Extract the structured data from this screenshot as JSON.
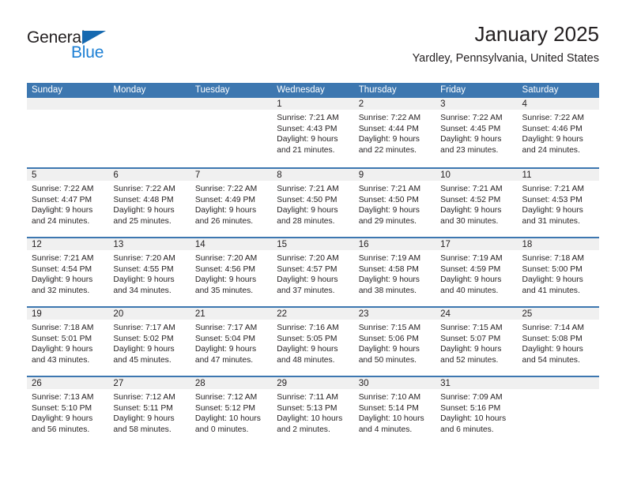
{
  "brand": {
    "name_part1": "General",
    "name_part2": "Blue",
    "triangle_icon": "triangle-icon",
    "colors": {
      "dark": "#231f20",
      "blue": "#1c7fd4",
      "triangle": "#1669b0"
    }
  },
  "header": {
    "month_title": "January 2025",
    "location": "Yardley, Pennsylvania, United States"
  },
  "calendar": {
    "header_color": "#3d77b0",
    "day_band_color": "#f0f0f0",
    "day_names": [
      "Sunday",
      "Monday",
      "Tuesday",
      "Wednesday",
      "Thursday",
      "Friday",
      "Saturday"
    ],
    "weeks": [
      [
        {
          "day": "",
          "empty": true
        },
        {
          "day": "",
          "empty": true
        },
        {
          "day": "",
          "empty": true
        },
        {
          "day": "1",
          "sunrise": "Sunrise: 7:21 AM",
          "sunset": "Sunset: 4:43 PM",
          "daylight1": "Daylight: 9 hours",
          "daylight2": "and 21 minutes."
        },
        {
          "day": "2",
          "sunrise": "Sunrise: 7:22 AM",
          "sunset": "Sunset: 4:44 PM",
          "daylight1": "Daylight: 9 hours",
          "daylight2": "and 22 minutes."
        },
        {
          "day": "3",
          "sunrise": "Sunrise: 7:22 AM",
          "sunset": "Sunset: 4:45 PM",
          "daylight1": "Daylight: 9 hours",
          "daylight2": "and 23 minutes."
        },
        {
          "day": "4",
          "sunrise": "Sunrise: 7:22 AM",
          "sunset": "Sunset: 4:46 PM",
          "daylight1": "Daylight: 9 hours",
          "daylight2": "and 24 minutes."
        }
      ],
      [
        {
          "day": "5",
          "sunrise": "Sunrise: 7:22 AM",
          "sunset": "Sunset: 4:47 PM",
          "daylight1": "Daylight: 9 hours",
          "daylight2": "and 24 minutes."
        },
        {
          "day": "6",
          "sunrise": "Sunrise: 7:22 AM",
          "sunset": "Sunset: 4:48 PM",
          "daylight1": "Daylight: 9 hours",
          "daylight2": "and 25 minutes."
        },
        {
          "day": "7",
          "sunrise": "Sunrise: 7:22 AM",
          "sunset": "Sunset: 4:49 PM",
          "daylight1": "Daylight: 9 hours",
          "daylight2": "and 26 minutes."
        },
        {
          "day": "8",
          "sunrise": "Sunrise: 7:21 AM",
          "sunset": "Sunset: 4:50 PM",
          "daylight1": "Daylight: 9 hours",
          "daylight2": "and 28 minutes."
        },
        {
          "day": "9",
          "sunrise": "Sunrise: 7:21 AM",
          "sunset": "Sunset: 4:50 PM",
          "daylight1": "Daylight: 9 hours",
          "daylight2": "and 29 minutes."
        },
        {
          "day": "10",
          "sunrise": "Sunrise: 7:21 AM",
          "sunset": "Sunset: 4:52 PM",
          "daylight1": "Daylight: 9 hours",
          "daylight2": "and 30 minutes."
        },
        {
          "day": "11",
          "sunrise": "Sunrise: 7:21 AM",
          "sunset": "Sunset: 4:53 PM",
          "daylight1": "Daylight: 9 hours",
          "daylight2": "and 31 minutes."
        }
      ],
      [
        {
          "day": "12",
          "sunrise": "Sunrise: 7:21 AM",
          "sunset": "Sunset: 4:54 PM",
          "daylight1": "Daylight: 9 hours",
          "daylight2": "and 32 minutes."
        },
        {
          "day": "13",
          "sunrise": "Sunrise: 7:20 AM",
          "sunset": "Sunset: 4:55 PM",
          "daylight1": "Daylight: 9 hours",
          "daylight2": "and 34 minutes."
        },
        {
          "day": "14",
          "sunrise": "Sunrise: 7:20 AM",
          "sunset": "Sunset: 4:56 PM",
          "daylight1": "Daylight: 9 hours",
          "daylight2": "and 35 minutes."
        },
        {
          "day": "15",
          "sunrise": "Sunrise: 7:20 AM",
          "sunset": "Sunset: 4:57 PM",
          "daylight1": "Daylight: 9 hours",
          "daylight2": "and 37 minutes."
        },
        {
          "day": "16",
          "sunrise": "Sunrise: 7:19 AM",
          "sunset": "Sunset: 4:58 PM",
          "daylight1": "Daylight: 9 hours",
          "daylight2": "and 38 minutes."
        },
        {
          "day": "17",
          "sunrise": "Sunrise: 7:19 AM",
          "sunset": "Sunset: 4:59 PM",
          "daylight1": "Daylight: 9 hours",
          "daylight2": "and 40 minutes."
        },
        {
          "day": "18",
          "sunrise": "Sunrise: 7:18 AM",
          "sunset": "Sunset: 5:00 PM",
          "daylight1": "Daylight: 9 hours",
          "daylight2": "and 41 minutes."
        }
      ],
      [
        {
          "day": "19",
          "sunrise": "Sunrise: 7:18 AM",
          "sunset": "Sunset: 5:01 PM",
          "daylight1": "Daylight: 9 hours",
          "daylight2": "and 43 minutes."
        },
        {
          "day": "20",
          "sunrise": "Sunrise: 7:17 AM",
          "sunset": "Sunset: 5:02 PM",
          "daylight1": "Daylight: 9 hours",
          "daylight2": "and 45 minutes."
        },
        {
          "day": "21",
          "sunrise": "Sunrise: 7:17 AM",
          "sunset": "Sunset: 5:04 PM",
          "daylight1": "Daylight: 9 hours",
          "daylight2": "and 47 minutes."
        },
        {
          "day": "22",
          "sunrise": "Sunrise: 7:16 AM",
          "sunset": "Sunset: 5:05 PM",
          "daylight1": "Daylight: 9 hours",
          "daylight2": "and 48 minutes."
        },
        {
          "day": "23",
          "sunrise": "Sunrise: 7:15 AM",
          "sunset": "Sunset: 5:06 PM",
          "daylight1": "Daylight: 9 hours",
          "daylight2": "and 50 minutes."
        },
        {
          "day": "24",
          "sunrise": "Sunrise: 7:15 AM",
          "sunset": "Sunset: 5:07 PM",
          "daylight1": "Daylight: 9 hours",
          "daylight2": "and 52 minutes."
        },
        {
          "day": "25",
          "sunrise": "Sunrise: 7:14 AM",
          "sunset": "Sunset: 5:08 PM",
          "daylight1": "Daylight: 9 hours",
          "daylight2": "and 54 minutes."
        }
      ],
      [
        {
          "day": "26",
          "sunrise": "Sunrise: 7:13 AM",
          "sunset": "Sunset: 5:10 PM",
          "daylight1": "Daylight: 9 hours",
          "daylight2": "and 56 minutes."
        },
        {
          "day": "27",
          "sunrise": "Sunrise: 7:12 AM",
          "sunset": "Sunset: 5:11 PM",
          "daylight1": "Daylight: 9 hours",
          "daylight2": "and 58 minutes."
        },
        {
          "day": "28",
          "sunrise": "Sunrise: 7:12 AM",
          "sunset": "Sunset: 5:12 PM",
          "daylight1": "Daylight: 10 hours",
          "daylight2": "and 0 minutes."
        },
        {
          "day": "29",
          "sunrise": "Sunrise: 7:11 AM",
          "sunset": "Sunset: 5:13 PM",
          "daylight1": "Daylight: 10 hours",
          "daylight2": "and 2 minutes."
        },
        {
          "day": "30",
          "sunrise": "Sunrise: 7:10 AM",
          "sunset": "Sunset: 5:14 PM",
          "daylight1": "Daylight: 10 hours",
          "daylight2": "and 4 minutes."
        },
        {
          "day": "31",
          "sunrise": "Sunrise: 7:09 AM",
          "sunset": "Sunset: 5:16 PM",
          "daylight1": "Daylight: 10 hours",
          "daylight2": "and 6 minutes."
        },
        {
          "day": "",
          "empty": true
        }
      ]
    ]
  }
}
